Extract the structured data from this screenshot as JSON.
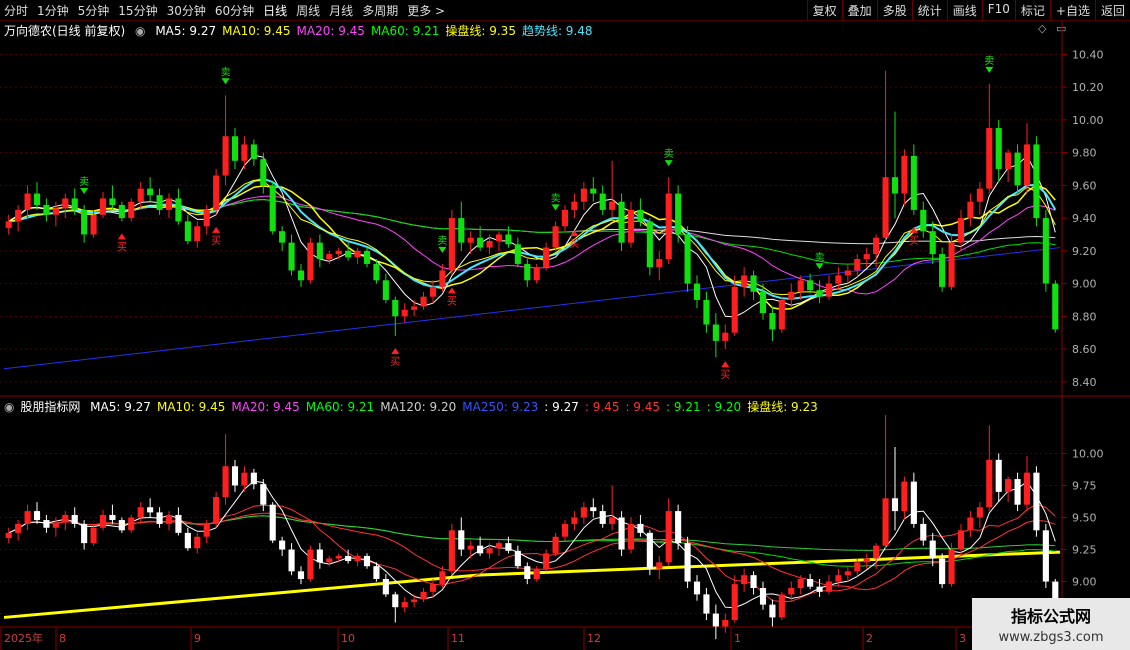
{
  "toolbar": {
    "periods": [
      "分时",
      "1分钟",
      "5分钟",
      "15分钟",
      "30分钟",
      "60分钟",
      "日线",
      "周线",
      "月线",
      "多周期",
      "更多 >"
    ],
    "active_period": "日线",
    "tools": [
      "复权",
      "叠加",
      "多股",
      "统计",
      "画线",
      "F10",
      "标记",
      "+自选",
      "返回"
    ]
  },
  "main_panel": {
    "title": "万向德农(日线 前复权)",
    "legend": [
      {
        "label": "MA5: 9.27",
        "color": "#ffffff"
      },
      {
        "label": "MA10: 9.45",
        "color": "#ffff00"
      },
      {
        "label": "MA20: 9.45",
        "color": "#ff44ff"
      },
      {
        "label": "MA60: 9.21",
        "color": "#00ff00"
      },
      {
        "label": "操盘线: 9.35",
        "color": "#ffff00"
      },
      {
        "label": "趋势线: 9.48",
        "color": "#44e8ff"
      }
    ],
    "price_ticks": [
      "10.40",
      "10.20",
      "10.00",
      "9.80",
      "9.60",
      "9.40",
      "9.20",
      "9.00",
      "8.80",
      "8.60",
      "8.40"
    ],
    "buy_label": "买",
    "sell_label": "卖"
  },
  "sub_panel": {
    "title": "股朋指标网",
    "legend": [
      {
        "label": "MA5: 9.27",
        "color": "#ffffff"
      },
      {
        "label": "MA10: 9.45",
        "color": "#ffff00"
      },
      {
        "label": "MA20: 9.45",
        "color": "#ff44ff"
      },
      {
        "label": "MA60: 9.21",
        "color": "#00ff00"
      },
      {
        "label": "MA120: 9.20",
        "color": "#cccccc"
      },
      {
        "label": "MA250: 9.23",
        "color": "#3355ff"
      },
      {
        "label": ": 9.27",
        "color": "#ffffff"
      },
      {
        "label": ": 9.45",
        "color": "#ff3333"
      },
      {
        "label": ": 9.45",
        "color": "#ff3333"
      },
      {
        "label": ": 9.21",
        "color": "#00ff00"
      },
      {
        "label": ": 9.20",
        "color": "#00ff00"
      },
      {
        "label": "操盘线: 9.23",
        "color": "#ffff00"
      }
    ],
    "price_ticks": [
      "10.00",
      "9.75",
      "9.50",
      "9.25",
      "9.00",
      "8.75"
    ]
  },
  "date_axis": [
    "2025年",
    "8",
    "9",
    "10",
    "11",
    "12",
    "1",
    "2",
    "3"
  ],
  "watermark": {
    "title": "指标公式网",
    "url": "www.zbgs3.com"
  },
  "chart_data": {
    "type": "candlestick",
    "title": "万向德农(日线 前复权)",
    "y_range_main": [
      8.35,
      10.5
    ],
    "y_range_sub": [
      8.7,
      10.3
    ],
    "ohlc": [
      [
        9.34,
        9.42,
        9.3,
        9.38
      ],
      [
        9.38,
        9.48,
        9.32,
        9.45
      ],
      [
        9.45,
        9.6,
        9.4,
        9.55
      ],
      [
        9.55,
        9.62,
        9.45,
        9.48
      ],
      [
        9.48,
        9.52,
        9.38,
        9.42
      ],
      [
        9.42,
        9.5,
        9.35,
        9.46
      ],
      [
        9.46,
        9.55,
        9.4,
        9.52
      ],
      [
        9.52,
        9.58,
        9.42,
        9.45
      ],
      [
        9.45,
        9.48,
        9.25,
        9.3
      ],
      [
        9.3,
        9.45,
        9.28,
        9.42
      ],
      [
        9.42,
        9.56,
        9.4,
        9.52
      ],
      [
        9.52,
        9.6,
        9.45,
        9.48
      ],
      [
        9.48,
        9.5,
        9.38,
        9.4
      ],
      [
        9.4,
        9.52,
        9.38,
        9.5
      ],
      [
        9.5,
        9.62,
        9.45,
        9.58
      ],
      [
        9.58,
        9.65,
        9.5,
        9.54
      ],
      [
        9.54,
        9.58,
        9.42,
        9.45
      ],
      [
        9.45,
        9.55,
        9.4,
        9.52
      ],
      [
        9.52,
        9.58,
        9.36,
        9.38
      ],
      [
        9.38,
        9.42,
        9.24,
        9.26
      ],
      [
        9.26,
        9.38,
        9.22,
        9.35
      ],
      [
        9.35,
        9.48,
        9.3,
        9.45
      ],
      [
        9.45,
        9.7,
        9.42,
        9.66
      ],
      [
        9.66,
        10.15,
        9.6,
        9.9
      ],
      [
        9.9,
        9.95,
        9.7,
        9.75
      ],
      [
        9.75,
        9.9,
        9.7,
        9.85
      ],
      [
        9.85,
        9.88,
        9.72,
        9.76
      ],
      [
        9.76,
        9.8,
        9.55,
        9.6
      ],
      [
        9.6,
        9.62,
        9.3,
        9.32
      ],
      [
        9.32,
        9.35,
        9.2,
        9.25
      ],
      [
        9.25,
        9.3,
        9.05,
        9.08
      ],
      [
        9.08,
        9.12,
        8.98,
        9.02
      ],
      [
        9.02,
        9.28,
        9.0,
        9.25
      ],
      [
        9.25,
        9.3,
        9.1,
        9.15
      ],
      [
        9.15,
        9.2,
        9.12,
        9.18
      ],
      [
        9.18,
        9.22,
        9.15,
        9.2
      ],
      [
        9.2,
        9.25,
        9.14,
        9.16
      ],
      [
        9.16,
        9.22,
        9.12,
        9.2
      ],
      [
        9.2,
        9.22,
        9.1,
        9.12
      ],
      [
        9.12,
        9.15,
        9.0,
        9.02
      ],
      [
        9.02,
        9.06,
        8.88,
        8.9
      ],
      [
        8.9,
        8.92,
        8.68,
        8.8
      ],
      [
        8.8,
        8.88,
        8.76,
        8.84
      ],
      [
        8.84,
        8.9,
        8.8,
        8.86
      ],
      [
        8.86,
        8.95,
        8.84,
        8.92
      ],
      [
        8.92,
        9.02,
        8.88,
        8.98
      ],
      [
        8.98,
        9.12,
        8.95,
        9.08
      ],
      [
        9.08,
        9.45,
        9.05,
        9.4
      ],
      [
        9.4,
        9.5,
        9.2,
        9.25
      ],
      [
        9.25,
        9.32,
        9.18,
        9.28
      ],
      [
        9.28,
        9.35,
        9.2,
        9.22
      ],
      [
        9.22,
        9.3,
        9.18,
        9.26
      ],
      [
        9.26,
        9.32,
        9.2,
        9.3
      ],
      [
        9.3,
        9.35,
        9.22,
        9.24
      ],
      [
        9.24,
        9.28,
        9.1,
        9.12
      ],
      [
        9.12,
        9.15,
        8.98,
        9.02
      ],
      [
        9.02,
        9.12,
        9.0,
        9.1
      ],
      [
        9.1,
        9.25,
        9.08,
        9.22
      ],
      [
        9.22,
        9.38,
        9.2,
        9.35
      ],
      [
        9.35,
        9.48,
        9.32,
        9.45
      ],
      [
        9.45,
        9.55,
        9.4,
        9.5
      ],
      [
        9.5,
        9.62,
        9.45,
        9.58
      ],
      [
        9.58,
        9.65,
        9.5,
        9.55
      ],
      [
        9.55,
        9.6,
        9.42,
        9.45
      ],
      [
        9.45,
        9.75,
        9.4,
        9.5
      ],
      [
        9.5,
        9.55,
        9.2,
        9.25
      ],
      [
        9.25,
        9.5,
        9.22,
        9.45
      ],
      [
        9.45,
        9.52,
        9.35,
        9.38
      ],
      [
        9.38,
        9.4,
        9.05,
        9.1
      ],
      [
        9.1,
        9.2,
        9.02,
        9.15
      ],
      [
        9.15,
        9.65,
        9.12,
        9.55
      ],
      [
        9.55,
        9.6,
        9.25,
        9.3
      ],
      [
        9.3,
        9.35,
        8.95,
        9.0
      ],
      [
        9.0,
        9.05,
        8.85,
        8.9
      ],
      [
        8.9,
        8.95,
        8.7,
        8.75
      ],
      [
        8.75,
        8.82,
        8.55,
        8.65
      ],
      [
        8.65,
        8.75,
        8.6,
        8.7
      ],
      [
        8.7,
        9.05,
        8.68,
        8.98
      ],
      [
        8.98,
        9.1,
        8.92,
        9.05
      ],
      [
        9.05,
        9.08,
        8.9,
        8.95
      ],
      [
        8.95,
        9.0,
        8.78,
        8.82
      ],
      [
        8.82,
        8.86,
        8.65,
        8.72
      ],
      [
        8.72,
        8.92,
        8.7,
        8.9
      ],
      [
        8.9,
        9.0,
        8.85,
        8.95
      ],
      [
        8.95,
        9.05,
        8.9,
        9.02
      ],
      [
        9.02,
        9.06,
        8.94,
        8.96
      ],
      [
        8.96,
        9.02,
        8.88,
        8.92
      ],
      [
        8.92,
        9.05,
        8.9,
        9.0
      ],
      [
        9.0,
        9.1,
        8.96,
        9.05
      ],
      [
        9.05,
        9.12,
        9.0,
        9.08
      ],
      [
        9.08,
        9.18,
        9.04,
        9.15
      ],
      [
        9.15,
        9.22,
        9.1,
        9.18
      ],
      [
        9.18,
        9.3,
        9.1,
        9.28
      ],
      [
        9.28,
        10.3,
        9.25,
        9.65
      ],
      [
        9.65,
        10.05,
        9.4,
        9.55
      ],
      [
        9.55,
        9.82,
        9.48,
        9.78
      ],
      [
        9.78,
        9.85,
        9.42,
        9.45
      ],
      [
        9.45,
        9.5,
        9.28,
        9.32
      ],
      [
        9.32,
        9.38,
        9.12,
        9.18
      ],
      [
        9.18,
        9.22,
        8.95,
        8.98
      ],
      [
        8.98,
        9.3,
        8.96,
        9.25
      ],
      [
        9.25,
        9.45,
        9.2,
        9.4
      ],
      [
        9.4,
        9.55,
        9.35,
        9.5
      ],
      [
        9.5,
        9.62,
        9.42,
        9.58
      ],
      [
        9.58,
        10.22,
        9.55,
        9.95
      ],
      [
        9.95,
        10.0,
        9.62,
        9.7
      ],
      [
        9.7,
        9.82,
        9.62,
        9.8
      ],
      [
        9.8,
        9.85,
        9.55,
        9.6
      ],
      [
        9.6,
        9.98,
        9.55,
        9.85
      ],
      [
        9.85,
        9.9,
        9.35,
        9.4
      ],
      [
        9.4,
        9.45,
        8.95,
        9.0
      ],
      [
        9.0,
        9.02,
        8.7,
        8.72
      ]
    ],
    "series": [
      {
        "name": "MA5",
        "color": "#ffffff"
      },
      {
        "name": "MA10",
        "color": "#ffff00"
      },
      {
        "name": "MA20",
        "color": "#ff44ff"
      },
      {
        "name": "MA60",
        "color": "#00ff00"
      },
      {
        "name": "MA120",
        "color": "#cccccc"
      },
      {
        "name": "MA250",
        "color": "#3355ff"
      },
      {
        "name": "趋势线",
        "color": "#44e8ff"
      },
      {
        "name": "操盘线",
        "color": "#ffff00"
      }
    ],
    "colors": {
      "up": "#ff1f1f",
      "down_main": "#10e010",
      "down_sub": "#ffffff",
      "grid": "#550000",
      "border": "#8b0000"
    }
  }
}
